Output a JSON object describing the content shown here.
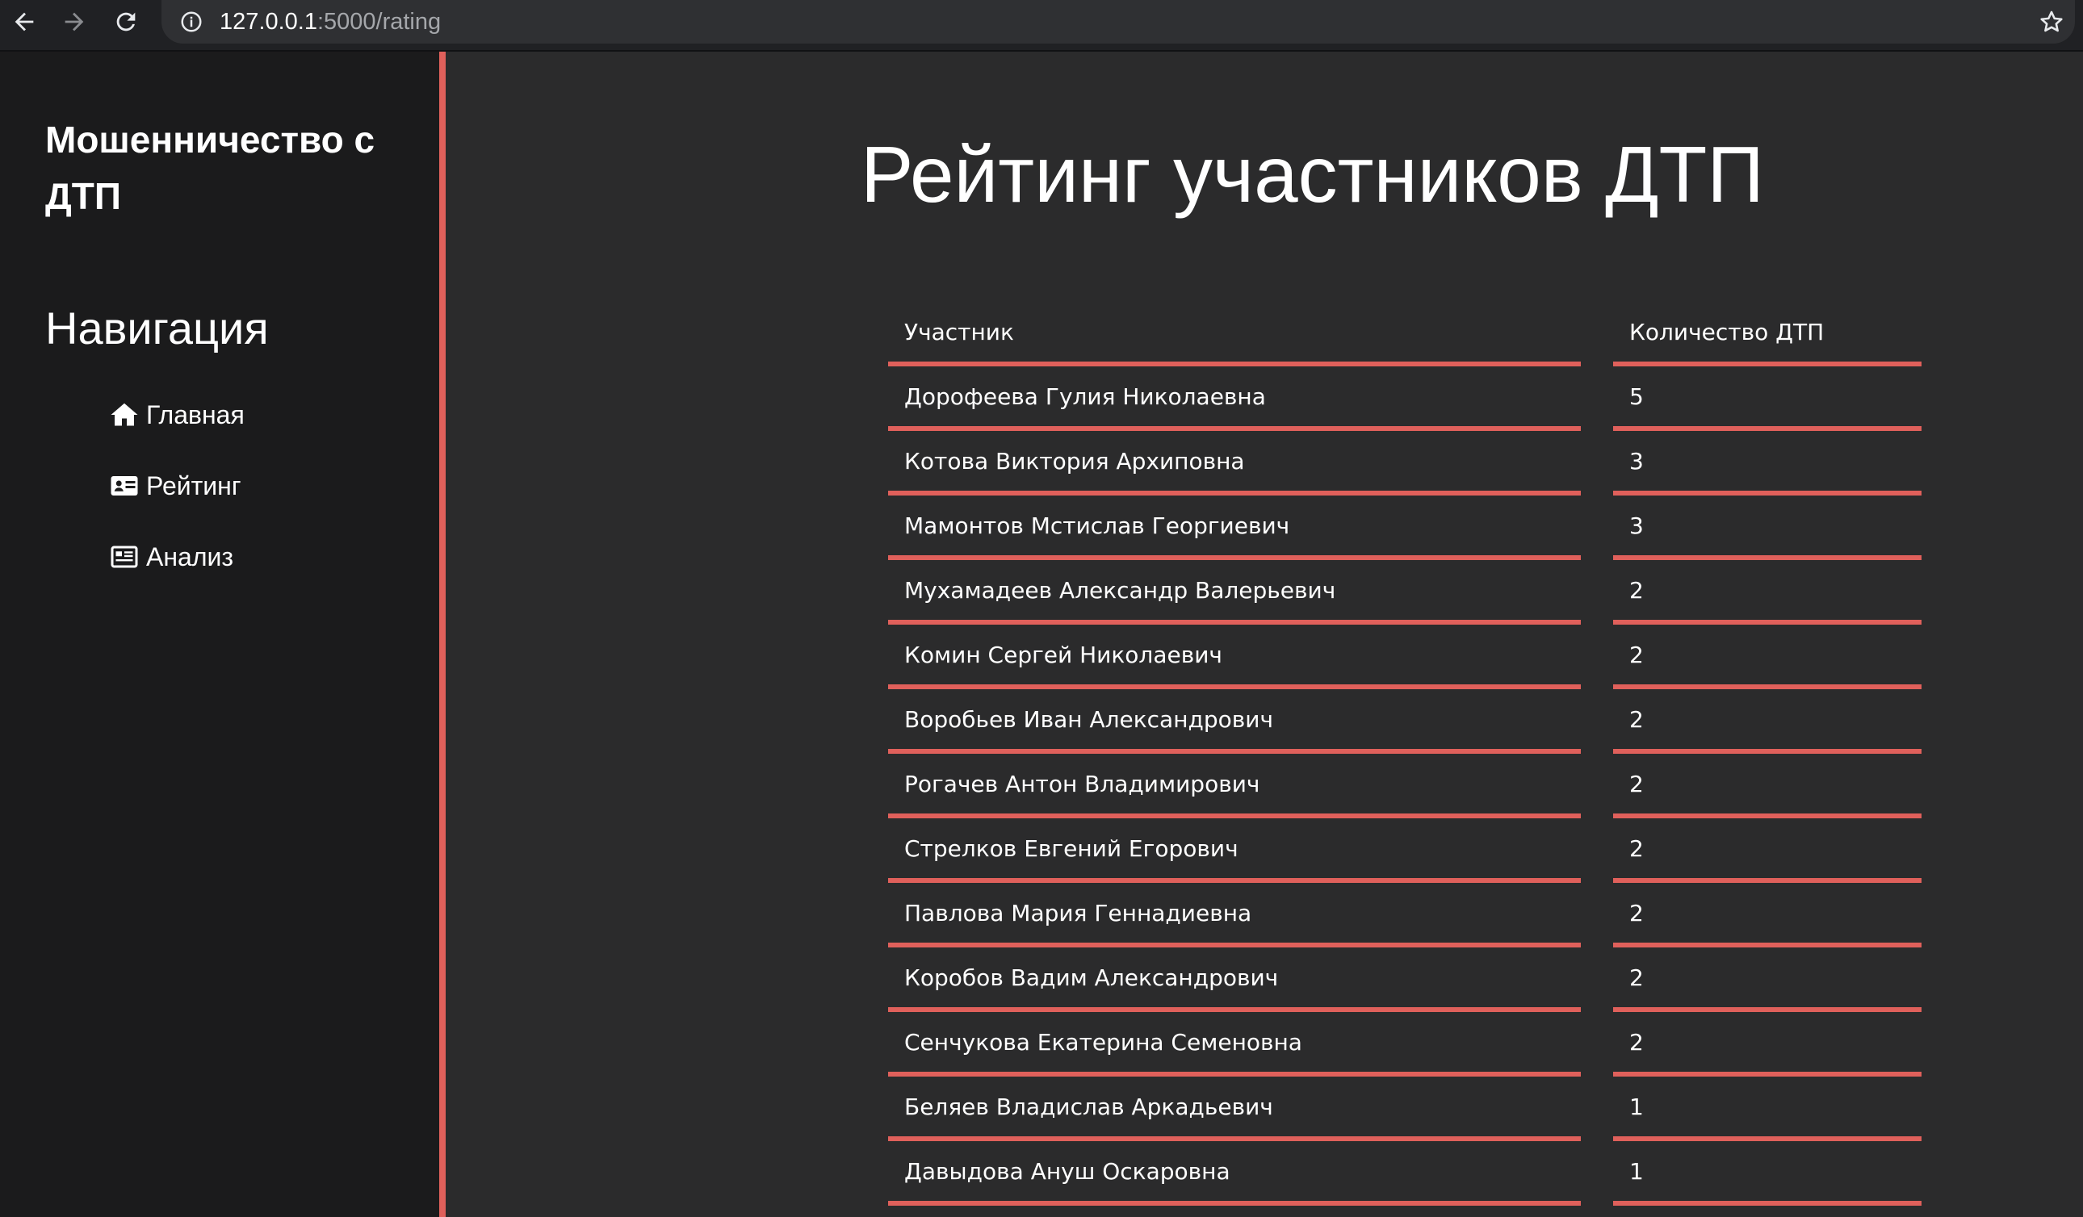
{
  "browser": {
    "url_host": "127.0.0.1",
    "url_path": ":5000/rating",
    "icons": [
      "back-icon",
      "forward-icon",
      "reload-icon",
      "site-info-icon",
      "bookmark-star-icon"
    ]
  },
  "sidebar": {
    "brand": "Мошенничество с ДТП",
    "nav_heading": "Навигация",
    "items": [
      {
        "label": "Главная",
        "icon": "home-icon"
      },
      {
        "label": "Рейтинг",
        "icon": "id-card-icon"
      },
      {
        "label": "Анализ",
        "icon": "newspaper-icon"
      }
    ]
  },
  "main": {
    "title": "Рейтинг участников ДТП",
    "table": {
      "headers": [
        "Участник",
        "Количество ДТП"
      ],
      "rows": [
        {
          "name": "Дорофеева Гулия Николаевна",
          "count": "5"
        },
        {
          "name": "Котова Виктория Архиповна",
          "count": "3"
        },
        {
          "name": "Мамонтов Мстислав Георгиевич",
          "count": "3"
        },
        {
          "name": "Мухамадеев Александр Валерьевич",
          "count": "2"
        },
        {
          "name": "Комин Сергей Николаевич",
          "count": "2"
        },
        {
          "name": "Воробьев Иван Александрович",
          "count": "2"
        },
        {
          "name": "Рогачев Антон Владимирович",
          "count": "2"
        },
        {
          "name": "Стрелков Евгений Егорович",
          "count": "2"
        },
        {
          "name": "Павлова Мария Геннадиевна",
          "count": "2"
        },
        {
          "name": "Коробов Вадим Александрович",
          "count": "2"
        },
        {
          "name": "Сенчукова Екатерина Семеновна",
          "count": "2"
        },
        {
          "name": "Беляев Владислав Аркадьевич",
          "count": "1"
        },
        {
          "name": "Давыдова Ануш Оскаровна",
          "count": "1"
        }
      ]
    }
  },
  "colors": {
    "accent": "#e0605b",
    "sidebar_bg": "#1b1b1c",
    "main_bg": "#2b2b2c"
  }
}
